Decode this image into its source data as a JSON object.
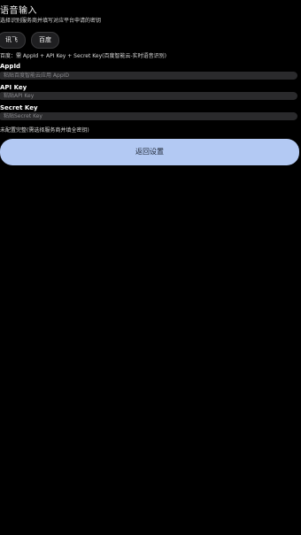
{
  "header": {
    "title": "语音输入",
    "subtitle": "选择识别服务商并填写对应平台申请的密钥"
  },
  "providers": [
    {
      "label": "讯飞"
    },
    {
      "label": "百度"
    }
  ],
  "hint": "百度：需 AppId + API Key + Secret Key(百度智能云-实时语音识别)",
  "fields": {
    "app_id": {
      "label": "AppId",
      "placeholder": "粘贴百度智能云应用 AppID",
      "value": ""
    },
    "api_key": {
      "label": "API Key",
      "placeholder": "粘贴API Key",
      "value": ""
    },
    "secret_key": {
      "label": "Secret Key",
      "placeholder": "粘贴Secret Key",
      "value": ""
    }
  },
  "config_note": "未配置完整(需选择服务商并填全密钥)",
  "actions": {
    "back_label": "返回设置"
  },
  "colors": {
    "background": "#000000",
    "input_background": "#2a2a2c",
    "primary_button": "#b3c9f3",
    "primary_button_text": "#1b2433"
  }
}
